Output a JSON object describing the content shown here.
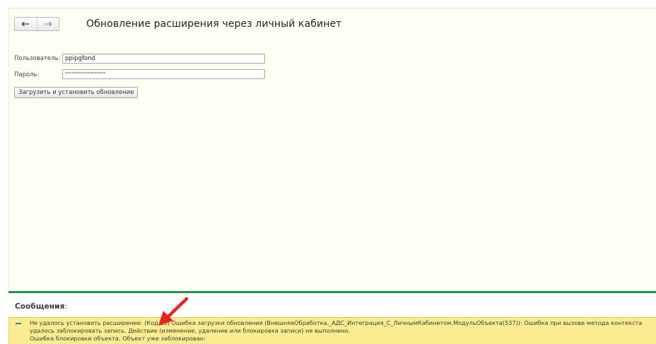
{
  "form": {
    "title": "Обновление расширения через личный кабинет",
    "user_label": "Пользователь:",
    "user_value": "ppipgfond",
    "password_label": "Пароль:",
    "password_value": "******************",
    "submit_label": "Загрузить и установить обновление"
  },
  "messages": {
    "title": "Сообщения",
    "title_suffix": ":",
    "lines": [
      "Не удалось установить расширение: (Код 23) Ошибка загрузки обновления (ВнешняяОбработка._АДС_Интеграция_С_ЛичнымКабинетом.МодульОбъекта(537)): Ошибка при вызове метода контекста",
      "удалось заблокировать запись. Действие (изменение, удаление или блокировка записи) не выполнено.",
      "Ошибка блокировки объекта. Объект уже заблокирован:"
    ]
  },
  "colors": {
    "accent_green": "#199a45",
    "message_bg": "#fbec90",
    "arrow_red": "#e8231d"
  },
  "icons": [
    "back-arrow-icon",
    "forward-arrow-icon",
    "message-dash-icon",
    "pointer-arrow-icon"
  ]
}
